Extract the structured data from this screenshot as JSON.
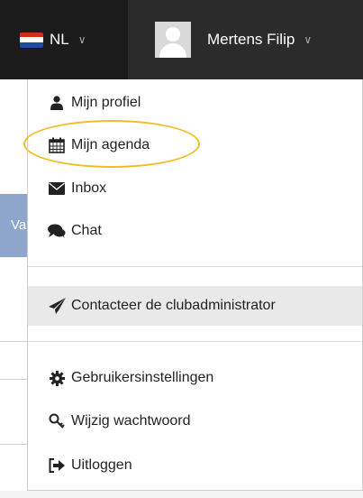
{
  "topbar": {
    "language": "NL",
    "user_name": "Mertens Filip"
  },
  "background": {
    "partial_text": "Va"
  },
  "menu": {
    "items": [
      {
        "label": "Mijn profiel",
        "icon": "user-icon"
      },
      {
        "label": "Mijn agenda",
        "icon": "calendar-icon"
      },
      {
        "label": "Inbox",
        "icon": "envelope-icon"
      },
      {
        "label": "Chat",
        "icon": "chat-bubbles-icon"
      },
      {
        "label": "Contacteer de clubadministrator",
        "icon": "send-icon"
      },
      {
        "label": "Gebruikersinstellingen",
        "icon": "gear-icon"
      },
      {
        "label": "Wijzig wachtwoord",
        "icon": "key-icon"
      },
      {
        "label": "Uitloggen",
        "icon": "logout-icon"
      }
    ]
  },
  "colors": {
    "topbar": "#1b1b1b",
    "user_area": "#2b2b2b",
    "highlight_circle": "#f0be28",
    "hover_row": "#e9e9e9"
  }
}
